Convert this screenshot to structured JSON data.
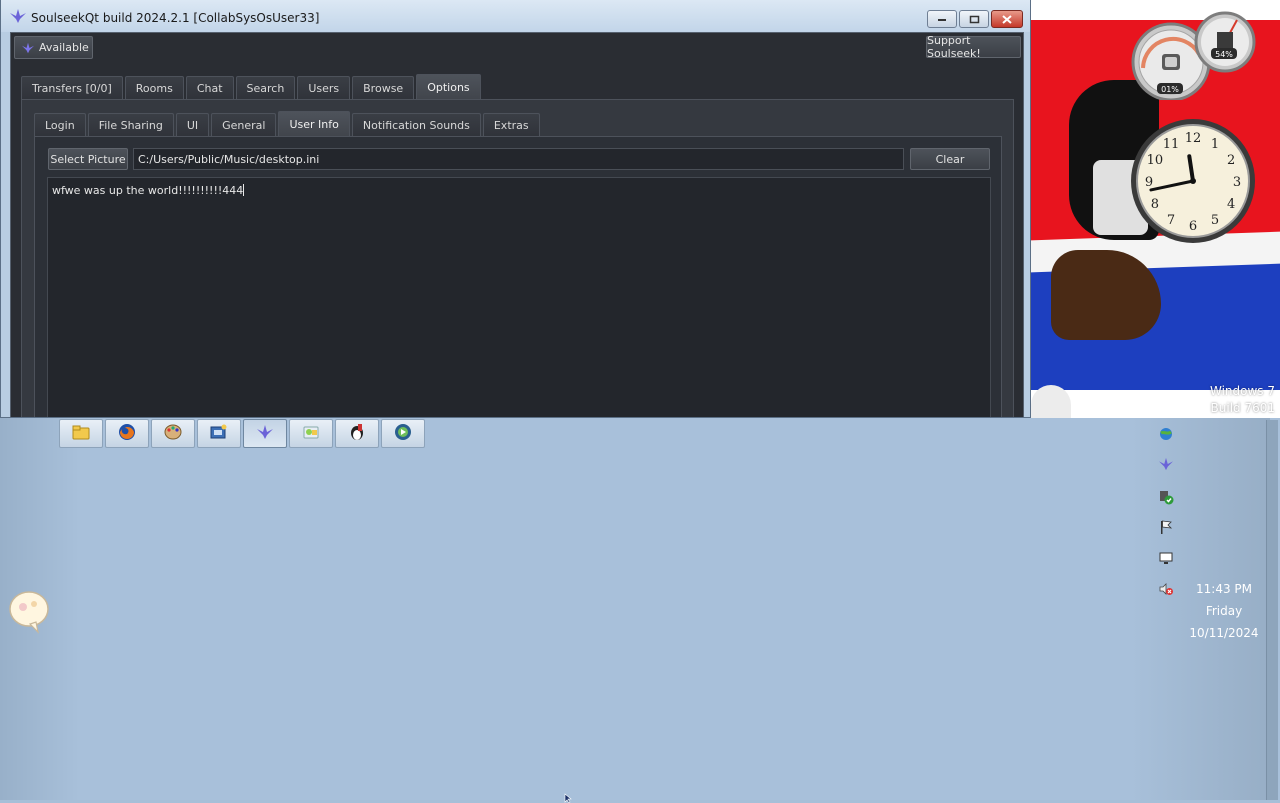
{
  "window": {
    "title": "SoulseekQt build 2024.2.1 [CollabSysOsUser33]",
    "status_button": "Available",
    "support_button": "Support Soulseek!"
  },
  "main_tabs": [
    {
      "label": "Transfers [0/0]",
      "active": false
    },
    {
      "label": "Rooms",
      "active": false
    },
    {
      "label": "Chat",
      "active": false
    },
    {
      "label": "Search",
      "active": false
    },
    {
      "label": "Users",
      "active": false
    },
    {
      "label": "Browse",
      "active": false
    },
    {
      "label": "Options",
      "active": true
    }
  ],
  "options_tabs": [
    {
      "label": "Login",
      "active": false
    },
    {
      "label": "File Sharing",
      "active": false
    },
    {
      "label": "UI",
      "active": false
    },
    {
      "label": "General",
      "active": false
    },
    {
      "label": "User Info",
      "active": true
    },
    {
      "label": "Notification Sounds",
      "active": false
    },
    {
      "label": "Extras",
      "active": false
    }
  ],
  "user_info": {
    "select_picture_label": "Select Picture",
    "picture_path": "C:/Users/Public/Music/desktop.ini",
    "clear_label": "Clear",
    "info_text": "wfwe was up the world!!!!!!!!!!444"
  },
  "desktop": {
    "watermark_line1": "Windows 7",
    "watermark_line2": "Build 7601",
    "gadget_cpu": "01%",
    "gadget_ram": "54%",
    "clock_numbers": [
      "12",
      "1",
      "2",
      "3",
      "4",
      "5",
      "6",
      "7",
      "8",
      "9",
      "10",
      "11"
    ],
    "clock_time": {
      "hour": 11,
      "minute": 43
    }
  },
  "quick_launch": [
    {
      "icon": "folder-icon",
      "pressed": false
    },
    {
      "icon": "firefox-icon",
      "pressed": false
    },
    {
      "icon": "paint-icon",
      "pressed": false
    },
    {
      "icon": "control-panel-icon",
      "pressed": false
    },
    {
      "icon": "soulseek-icon",
      "pressed": true
    },
    {
      "icon": "explorer-icon",
      "pressed": false
    },
    {
      "icon": "tux-icon",
      "pressed": false
    },
    {
      "icon": "media-player-icon",
      "pressed": false
    }
  ],
  "tray": {
    "icons": [
      "network-globe-icon",
      "soulseek-tray-icon",
      "security-check-icon",
      "action-center-flag-icon",
      "display-network-icon",
      "volume-muted-icon"
    ],
    "time": "11:43 PM",
    "day": "Friday",
    "date": "10/11/2024"
  },
  "colors": {
    "app_dark": "#2a2d33",
    "desktop_blue": "#a8c0da",
    "accent_purple": "#6b63d8"
  }
}
